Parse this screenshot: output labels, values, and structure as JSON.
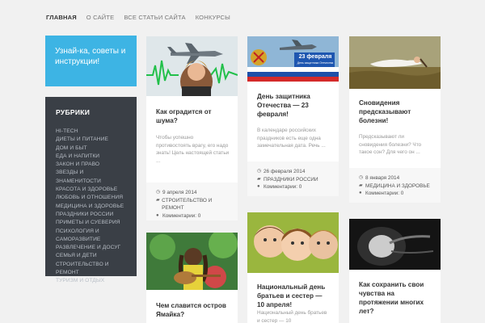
{
  "nav": [
    "ГЛАВНАЯ",
    "О САЙТЕ",
    "ВСЕ СТАТЬИ САЙТА",
    "КОНКУРСЫ"
  ],
  "brand": "Узнай-ка, советы и инструкции!",
  "sidebar": {
    "title": "РУБРИКИ",
    "items": [
      "HI-TECH",
      "ДИЕТЫ И ПИТАНИЕ",
      "ДОМ И БЫТ",
      "ЕДА И НАПИТКИ",
      "ЗАКОН И ПРАВО",
      "ЗВЕЗДЫ И ЗНАМЕНИТОСТИ",
      "КРАСОТА И ЗДОРОВЬЕ",
      "ЛЮБОВЬ И ОТНОШЕНИЯ",
      "МЕДИЦИНА И ЗДОРОВЬЕ",
      "ПРАЗДНИКИ РОССИИ",
      "ПРИМЕТЫ И СУЕВЕРИЯ",
      "ПСИХОЛОГИЯ И САМОРАЗВИТИЕ",
      "РАЗВЛЕЧЕНИЕ И ДОСУГ",
      "СЕМЬЯ И ДЕТИ",
      "СТРОИТЕЛЬСТВО И РЕМОНТ",
      "ТУРИЗМ И ОТДЫХ"
    ]
  },
  "posts": [
    {
      "title": "Как оградится от шума?",
      "excerpt": "Чтобы успешно противостоять врагу, его надо знать! Цель настоящей статьи ...",
      "date": "9 апреля 2014",
      "category": "СТРОИТЕЛЬСТВО И РЕМОНТ",
      "comments": "Комментарии: 0"
    },
    {
      "title": "День защитника Отечества — 23 февраля!",
      "excerpt": "В календаре российских праздников есть еще одна замечательная дата. Речь ...",
      "date": "26 февраля 2014",
      "category": "ПРАЗДНИКИ РОССИИ",
      "comments": "Комментарии: 0",
      "banner_day": "23 февраля",
      "banner_sub": "День защитника Отечества"
    },
    {
      "title": "Сновидения предсказывают болезни!",
      "excerpt": "Предсказывают ли сновидения болезни? Что такое сон? Для чего он ...",
      "date": "8 января 2014",
      "category": "МЕДИЦИНА И ЗДОРОВЬЕ",
      "comments": "Комментарии: 0"
    },
    {
      "title": "Чем славится остров Ямайка?"
    },
    {
      "title": "Национальный день братьев и сестер — 10 апреля!",
      "excerpt": "Национальный день братьев и сестер — 10"
    },
    {
      "title": "Как сохранить свои чувства на протяжении многих лет?"
    }
  ]
}
